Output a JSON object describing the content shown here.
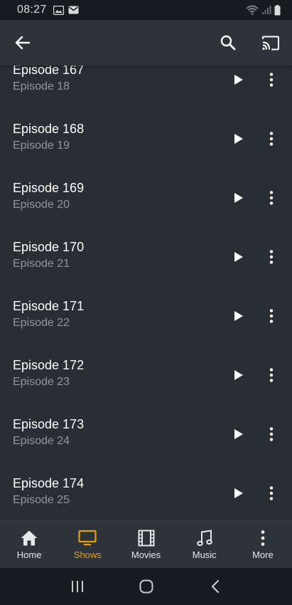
{
  "status_bar": {
    "time": "08:27"
  },
  "episodes": [
    {
      "title": "Episode 167",
      "subtitle": "Episode 18"
    },
    {
      "title": "Episode 168",
      "subtitle": "Episode 19"
    },
    {
      "title": "Episode 169",
      "subtitle": "Episode 20"
    },
    {
      "title": "Episode 170",
      "subtitle": "Episode 21"
    },
    {
      "title": "Episode 171",
      "subtitle": "Episode 22"
    },
    {
      "title": "Episode 172",
      "subtitle": "Episode 23"
    },
    {
      "title": "Episode 173",
      "subtitle": "Episode 24"
    },
    {
      "title": "Episode 174",
      "subtitle": "Episode 25"
    }
  ],
  "bottom_nav": {
    "items": [
      {
        "label": "Home",
        "icon": "home-icon"
      },
      {
        "label": "Shows",
        "icon": "tv-icon",
        "active": true
      },
      {
        "label": "Movies",
        "icon": "film-icon"
      },
      {
        "label": "Music",
        "icon": "music-note-icon"
      },
      {
        "label": "More",
        "icon": "more-vertical-icon"
      }
    ]
  },
  "colors": {
    "background": "#282e34",
    "app_bar": "#2d3339",
    "accent": "#e5a00d",
    "subtitle": "#8f969c"
  }
}
